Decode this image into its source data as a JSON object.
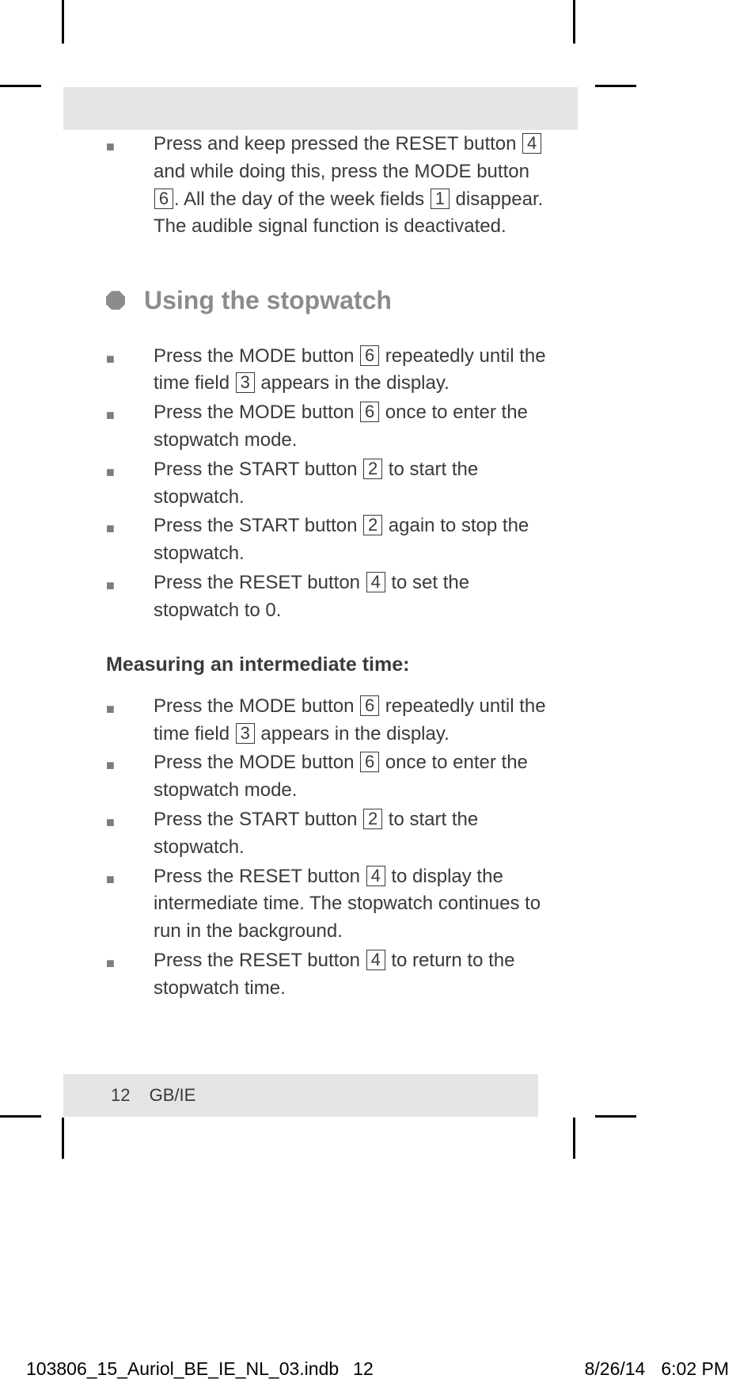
{
  "intro": {
    "p1a": "Press and keep pressed the RESET button ",
    "n4": "4",
    "p1b": " and while doing this, press the MODE button ",
    "n6": "6",
    "p1c": ". All the day of the week fields ",
    "n1": "1",
    "p1d": " disappear. The audible signal function is deactivated."
  },
  "section_heading": "Using the stopwatch",
  "stopwatch": [
    {
      "a": "Press the MODE button ",
      "n": "6",
      "b": " repeatedly until the time field ",
      "n2": "3",
      "c": " appears in the display."
    },
    {
      "a": "Press the MODE button ",
      "n": "6",
      "b": " once to enter the stopwatch mode."
    },
    {
      "a": "Press the START button ",
      "n": "2",
      "b": " to start the stopwatch."
    },
    {
      "a": "Press the START button ",
      "n": "2",
      "b": " again to stop the stopwatch."
    },
    {
      "a": "Press the RESET button ",
      "n": "4",
      "b": " to set the stopwatch to 0."
    }
  ],
  "subheading": "Measuring an intermediate time:",
  "intermediate": [
    {
      "a": "Press the MODE button ",
      "n": "6",
      "b": " repeatedly until the time field ",
      "n2": "3",
      "c": " appears in the display."
    },
    {
      "a": "Press the MODE button ",
      "n": "6",
      "b": " once to enter the stopwatch mode."
    },
    {
      "a": "Press the START button ",
      "n": "2",
      "b": " to start the stopwatch."
    },
    {
      "a": "Press the RESET button ",
      "n": "4",
      "b": " to display the intermediate time. The stopwatch continues to run in the background."
    },
    {
      "a": "Press the RESET button ",
      "n": "4",
      "b": " to return to the stopwatch time."
    }
  ],
  "footer": {
    "page": "12",
    "region": "GB/IE"
  },
  "slug": {
    "file": "103806_15_Auriol_BE_IE_NL_03.indb",
    "pn": "12",
    "date": "8/26/14",
    "time": "6:02 PM"
  }
}
